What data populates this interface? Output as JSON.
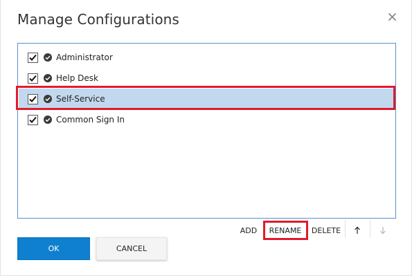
{
  "dialog": {
    "title": "Manage Configurations",
    "close_icon": "close-icon"
  },
  "list": {
    "items": [
      {
        "label": "Administrator",
        "checked": true,
        "selected": false
      },
      {
        "label": "Help Desk",
        "checked": true,
        "selected": false
      },
      {
        "label": "Self-Service",
        "checked": true,
        "selected": true
      },
      {
        "label": "Common Sign In",
        "checked": true,
        "selected": false
      }
    ]
  },
  "toolbar": {
    "add_label": "ADD",
    "rename_label": "RENAME",
    "delete_label": "DELETE",
    "move_up_icon": "arrow-up-icon",
    "move_down_icon": "arrow-down-icon"
  },
  "buttons": {
    "ok_label": "OK",
    "cancel_label": "CANCEL"
  },
  "colors": {
    "accent": "#0f7fcf",
    "selected_row": "#c2d8ee",
    "highlight": "#e01b2c",
    "list_border": "#5a8fc7"
  }
}
